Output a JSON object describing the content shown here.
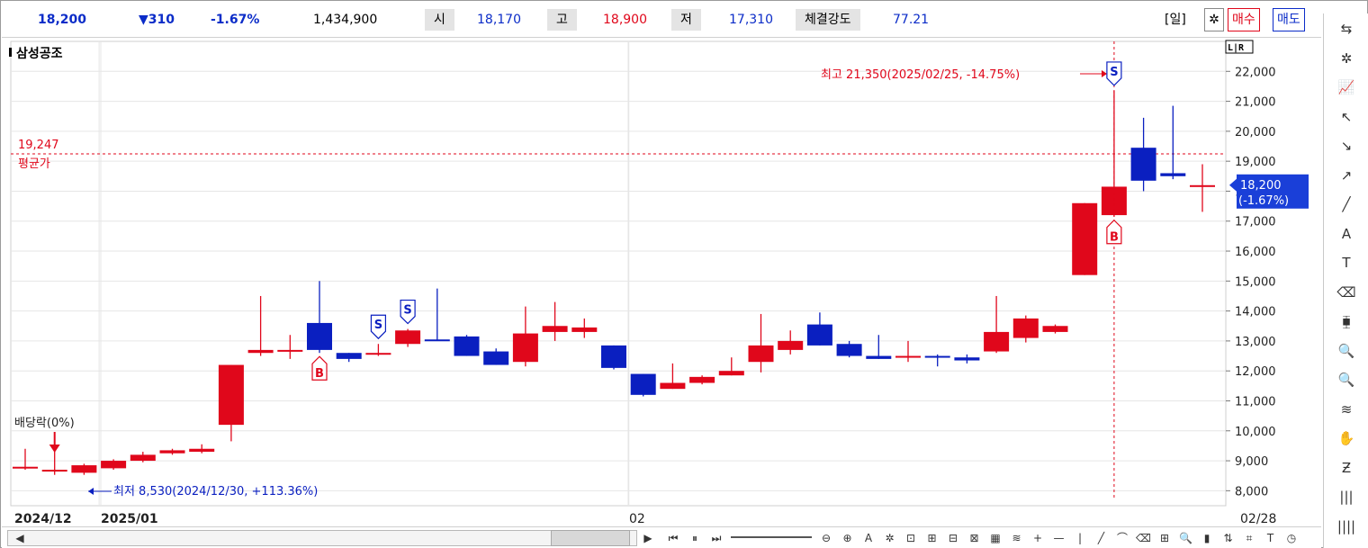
{
  "header": {
    "price": "18,200",
    "change": "▼310",
    "change_pct": "-1.67%",
    "volume": "1,434,900",
    "open_label": "시",
    "open": "18,170",
    "high_label": "고",
    "high": "18,900",
    "low_label": "저",
    "low": "17,310",
    "strength_label": "체결강도",
    "strength": "77.21",
    "period": "[일]",
    "buy_label": "매수",
    "sell_label": "매도",
    "lr_label": "L|R"
  },
  "chart_data": {
    "type": "candlestick",
    "title": "삼성공조",
    "ylim": [
      7500,
      23000
    ],
    "yticks": [
      8000,
      9000,
      10000,
      11000,
      12000,
      13000,
      14000,
      15000,
      16000,
      17000,
      18000,
      19000,
      20000,
      21000,
      22000
    ],
    "ytick_labels": [
      "8,000",
      "9,000",
      "10,000",
      "11,000",
      "12,000",
      "13,000",
      "14,000",
      "15,000",
      "16,000",
      "17,000",
      "18,000",
      "19,000",
      "20,000",
      "21,000",
      "22,000"
    ],
    "xaxis_labels": [
      {
        "index": 0,
        "label": "2024/12"
      },
      {
        "index": 3,
        "label": "2025/01"
      },
      {
        "index": 21,
        "label": "02"
      },
      {
        "index": 40,
        "label": "02/28"
      }
    ],
    "candles": [
      {
        "o": 8800,
        "h": 9400,
        "l": 8700,
        "c": 8800
      },
      {
        "o": 8700,
        "h": 9400,
        "l": 8530,
        "c": 8700
      },
      {
        "o": 8600,
        "h": 8900,
        "l": 8530,
        "c": 8850
      },
      {
        "o": 8750,
        "h": 9050,
        "l": 8700,
        "c": 9000
      },
      {
        "o": 9000,
        "h": 9300,
        "l": 8950,
        "c": 9200
      },
      {
        "o": 9250,
        "h": 9400,
        "l": 9200,
        "c": 9350
      },
      {
        "o": 9300,
        "h": 9550,
        "l": 9250,
        "c": 9400
      },
      {
        "o": 10200,
        "h": 12200,
        "l": 9650,
        "c": 12200
      },
      {
        "o": 12600,
        "h": 14500,
        "l": 12500,
        "c": 12700
      },
      {
        "o": 12700,
        "h": 13200,
        "l": 12400,
        "c": 12700
      },
      {
        "o": 13600,
        "h": 15000,
        "l": 12600,
        "c": 12700
      },
      {
        "o": 12600,
        "h": 12600,
        "l": 12300,
        "c": 12400
      },
      {
        "o": 12600,
        "h": 12900,
        "l": 12500,
        "c": 12600
      },
      {
        "o": 12900,
        "h": 13400,
        "l": 12800,
        "c": 13350
      },
      {
        "o": 13050,
        "h": 14750,
        "l": 13000,
        "c": 13000
      },
      {
        "o": 13150,
        "h": 13200,
        "l": 12500,
        "c": 12500
      },
      {
        "o": 12650,
        "h": 12750,
        "l": 12200,
        "c": 12200
      },
      {
        "o": 12300,
        "h": 14150,
        "l": 12150,
        "c": 13250
      },
      {
        "o": 13300,
        "h": 14300,
        "l": 13000,
        "c": 13500
      },
      {
        "o": 13300,
        "h": 13750,
        "l": 13100,
        "c": 13450
      },
      {
        "o": 12850,
        "h": 12850,
        "l": 12050,
        "c": 12100
      },
      {
        "o": 11900,
        "h": 11900,
        "l": 11150,
        "c": 11200
      },
      {
        "o": 11400,
        "h": 12250,
        "l": 11400,
        "c": 11600
      },
      {
        "o": 11600,
        "h": 11850,
        "l": 11550,
        "c": 11800
      },
      {
        "o": 11850,
        "h": 12450,
        "l": 11850,
        "c": 12000
      },
      {
        "o": 12300,
        "h": 13900,
        "l": 11950,
        "c": 12850
      },
      {
        "o": 12700,
        "h": 13350,
        "l": 12550,
        "c": 13000
      },
      {
        "o": 13550,
        "h": 13950,
        "l": 12850,
        "c": 12850
      },
      {
        "o": 12900,
        "h": 13000,
        "l": 12450,
        "c": 12500
      },
      {
        "o": 12500,
        "h": 13200,
        "l": 12400,
        "c": 12400
      },
      {
        "o": 12500,
        "h": 13000,
        "l": 12300,
        "c": 12500
      },
      {
        "o": 12500,
        "h": 12550,
        "l": 12150,
        "c": 12450
      },
      {
        "o": 12450,
        "h": 12550,
        "l": 12250,
        "c": 12350
      },
      {
        "o": 12650,
        "h": 14500,
        "l": 12600,
        "c": 13300
      },
      {
        "o": 13100,
        "h": 13850,
        "l": 12950,
        "c": 13750
      },
      {
        "o": 13300,
        "h": 13550,
        "l": 13250,
        "c": 13500
      },
      {
        "o": 15200,
        "h": 17600,
        "l": 15200,
        "c": 17600
      },
      {
        "o": 17200,
        "h": 21350,
        "l": 17150,
        "c": 18150
      },
      {
        "o": 19450,
        "h": 20450,
        "l": 18000,
        "c": 18350
      },
      {
        "o": 18600,
        "h": 20850,
        "l": 18400,
        "c": 18500
      },
      {
        "o": 18170,
        "h": 18900,
        "l": 17310,
        "c": 18200
      }
    ],
    "signals": [
      {
        "index": 10,
        "type": "B"
      },
      {
        "index": 12,
        "type": "S"
      },
      {
        "index": 13,
        "type": "S"
      },
      {
        "index": 37,
        "type": "S"
      },
      {
        "index": 37,
        "type": "B"
      }
    ],
    "avg_price": 19247,
    "avg_price_value": "19,247",
    "avg_price_label": "평균가",
    "high_annotation": "최고 21,350(2025/02/25, -14.75%)",
    "low_annotation": "최저 8,530(2024/12/30, +113.36%)",
    "dividend_label": "배당락(0%)",
    "current_label_price": "18,200",
    "current_label_pct": "(-1.67%)",
    "colors": {
      "up": "#e0071b",
      "down": "#0a1fc0",
      "grid": "#e6e6e6",
      "avg": "#e0071b"
    }
  },
  "toolbar": {
    "icons": [
      "refresh-icon",
      "gear-icon",
      "chart-indicator-icon",
      "cursor-add-icon",
      "cursor-down-icon",
      "cursor-up-icon",
      "line-icon",
      "auto-line-icon",
      "text-plus-icon",
      "all-delete-icon",
      "candle-type-icon",
      "zoom-info-icon",
      "zoom-list-icon",
      "compare-icon",
      "hand-icon",
      "z-icon",
      "bars-icon",
      "bars2-icon"
    ],
    "glyphs": [
      "⇆",
      "✲",
      "📈",
      "↖",
      "↘",
      "↗",
      "╱",
      "A",
      "T",
      "⌫",
      "⧯",
      "🔍",
      "🔍",
      "≋",
      "✋",
      "Ƶ",
      "|||",
      "||||"
    ]
  },
  "bottombar": {
    "glyphs": [
      "◀",
      "▶",
      "⏮",
      "⏸",
      "⏭",
      "⊖",
      "⊕",
      "A",
      "✲",
      "⊡",
      "⊞",
      "⊟",
      "⊠",
      "▦",
      "≋",
      "+",
      "—",
      "|",
      "╱",
      "⌒",
      "⌫",
      "⊞",
      "🔍",
      "▮",
      "⇅",
      "⌗",
      "T",
      "◷"
    ]
  }
}
